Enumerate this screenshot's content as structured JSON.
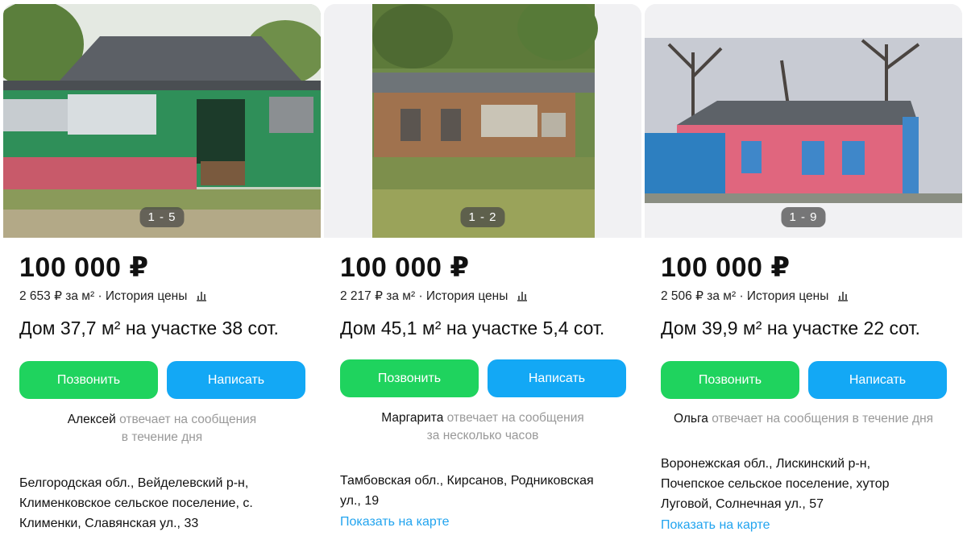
{
  "cards": [
    {
      "photo_counter": "1 - 5",
      "price": "100 000 ₽",
      "price_per_m2": "2 653 ₽ за м²",
      "history_label": "История цены",
      "title": "Дом 37,7 м² на участке 38 сот.",
      "call_label": "Позвонить",
      "write_label": "Написать",
      "seller": "Алексей",
      "response_line1": "отвечает на сообщения",
      "response_line2": "в течение дня",
      "address_lines": [
        "Белгородская обл., Вейделевский р-н,",
        "Клименковское сельское поселение, с.",
        "Клименки, Славянская ул., 33"
      ],
      "map_link": ""
    },
    {
      "photo_counter": "1 - 2",
      "price": "100 000 ₽",
      "price_per_m2": "2 217 ₽ за м²",
      "history_label": "История цены",
      "title": "Дом 45,1 м² на участке 5,4 сот.",
      "call_label": "Позвонить",
      "write_label": "Написать",
      "seller": "Маргарита",
      "response_line1": "отвечает на сообщения",
      "response_line2": "за несколько часов",
      "address_lines": [
        "Тамбовская обл., Кирсанов, Родниковская",
        "ул., 19"
      ],
      "map_link": "Показать на карте"
    },
    {
      "photo_counter": "1 - 9",
      "price": "100 000 ₽",
      "price_per_m2": "2 506 ₽ за м²",
      "history_label": "История цены",
      "title": "Дом 39,9 м² на участке 22 сот.",
      "call_label": "Позвонить",
      "write_label": "Написать",
      "seller": "Ольга",
      "response_line1": "отвечает на сообщения в течение дня",
      "response_line2": "",
      "address_lines": [
        "Воронежская обл., Лискинский р-н,",
        "Почепское сельское поселение, хутор",
        "Луговой, Солнечная ул., 57"
      ],
      "map_link": "Показать на карте"
    }
  ],
  "colors": {
    "call_button": "#1fd35e",
    "write_button": "#13a8f5",
    "link": "#22a4ef",
    "muted_text": "#999999"
  },
  "icons": {
    "price_history": "bar-chart-icon"
  }
}
